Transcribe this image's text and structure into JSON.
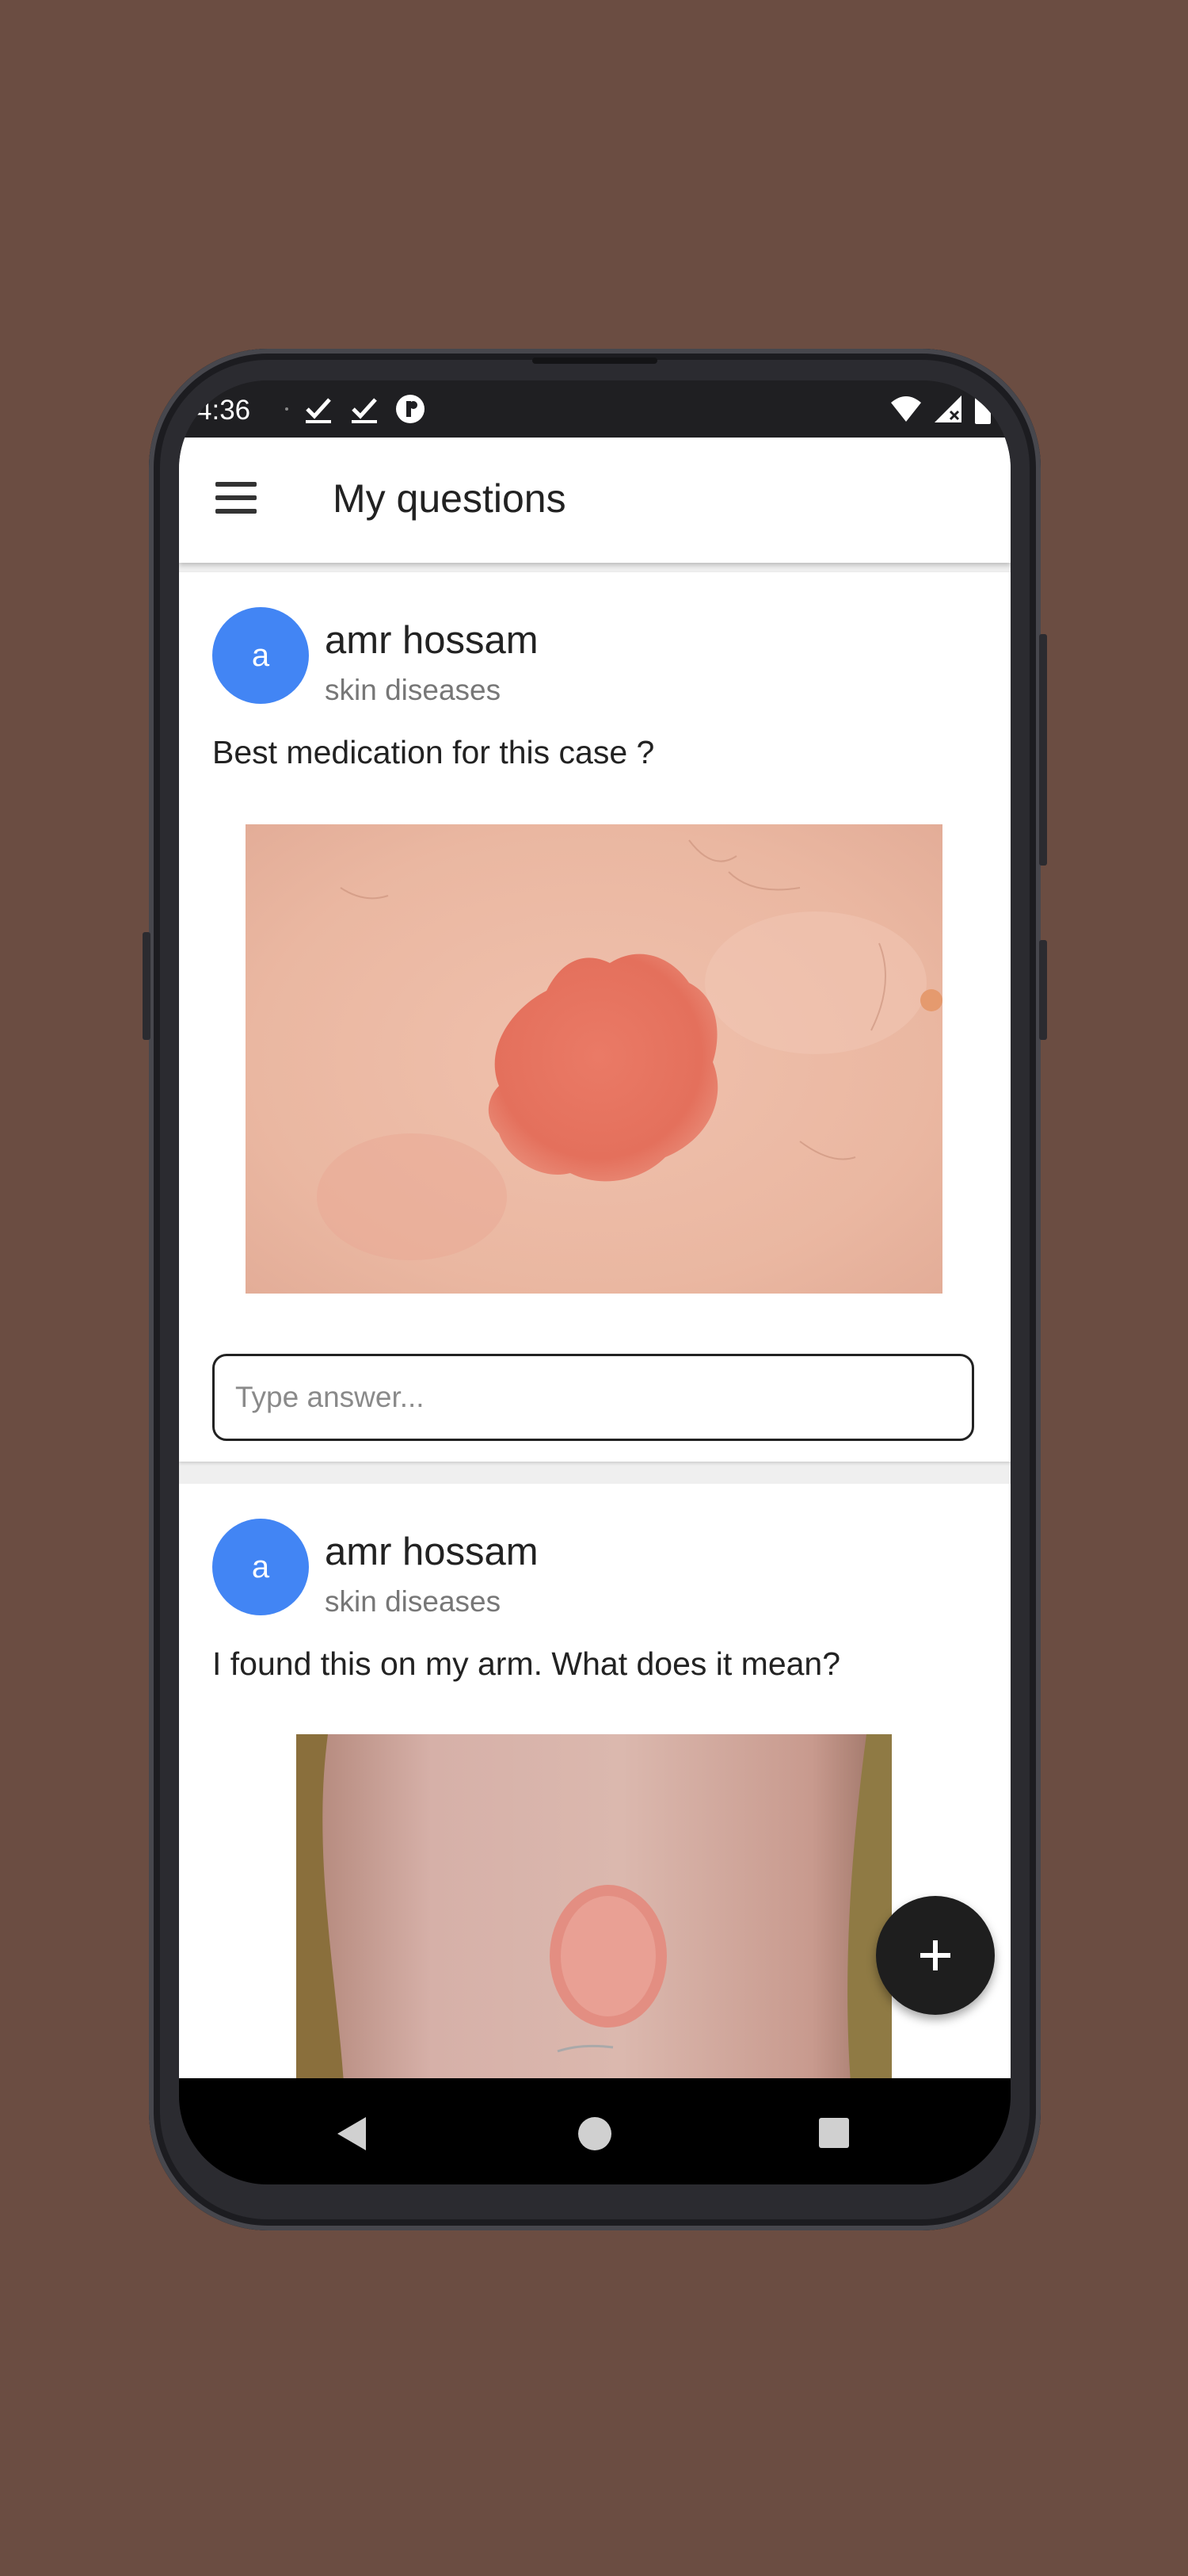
{
  "status_bar": {
    "time": "4:36"
  },
  "app_bar": {
    "title": "My questions"
  },
  "input_placeholder": "Type answer...",
  "posts": [
    {
      "avatar_letter": "a",
      "author": "amr hossam",
      "category": "skin diseases",
      "question": "Best medication for this case ?"
    },
    {
      "avatar_letter": "a",
      "author": "amr hossam",
      "category": "skin diseases",
      "question": "I found this on my arm. What does it mean?"
    }
  ],
  "icons": {
    "menu": "hamburger-menu-icon",
    "fab": "plus-icon",
    "nav_back": "triangle-back-icon",
    "nav_home": "circle-home-icon",
    "nav_recents": "square-recents-icon"
  },
  "colors": {
    "background": "#6b4d42",
    "avatar": "#4285f4",
    "fab": "#1e1e1e"
  }
}
